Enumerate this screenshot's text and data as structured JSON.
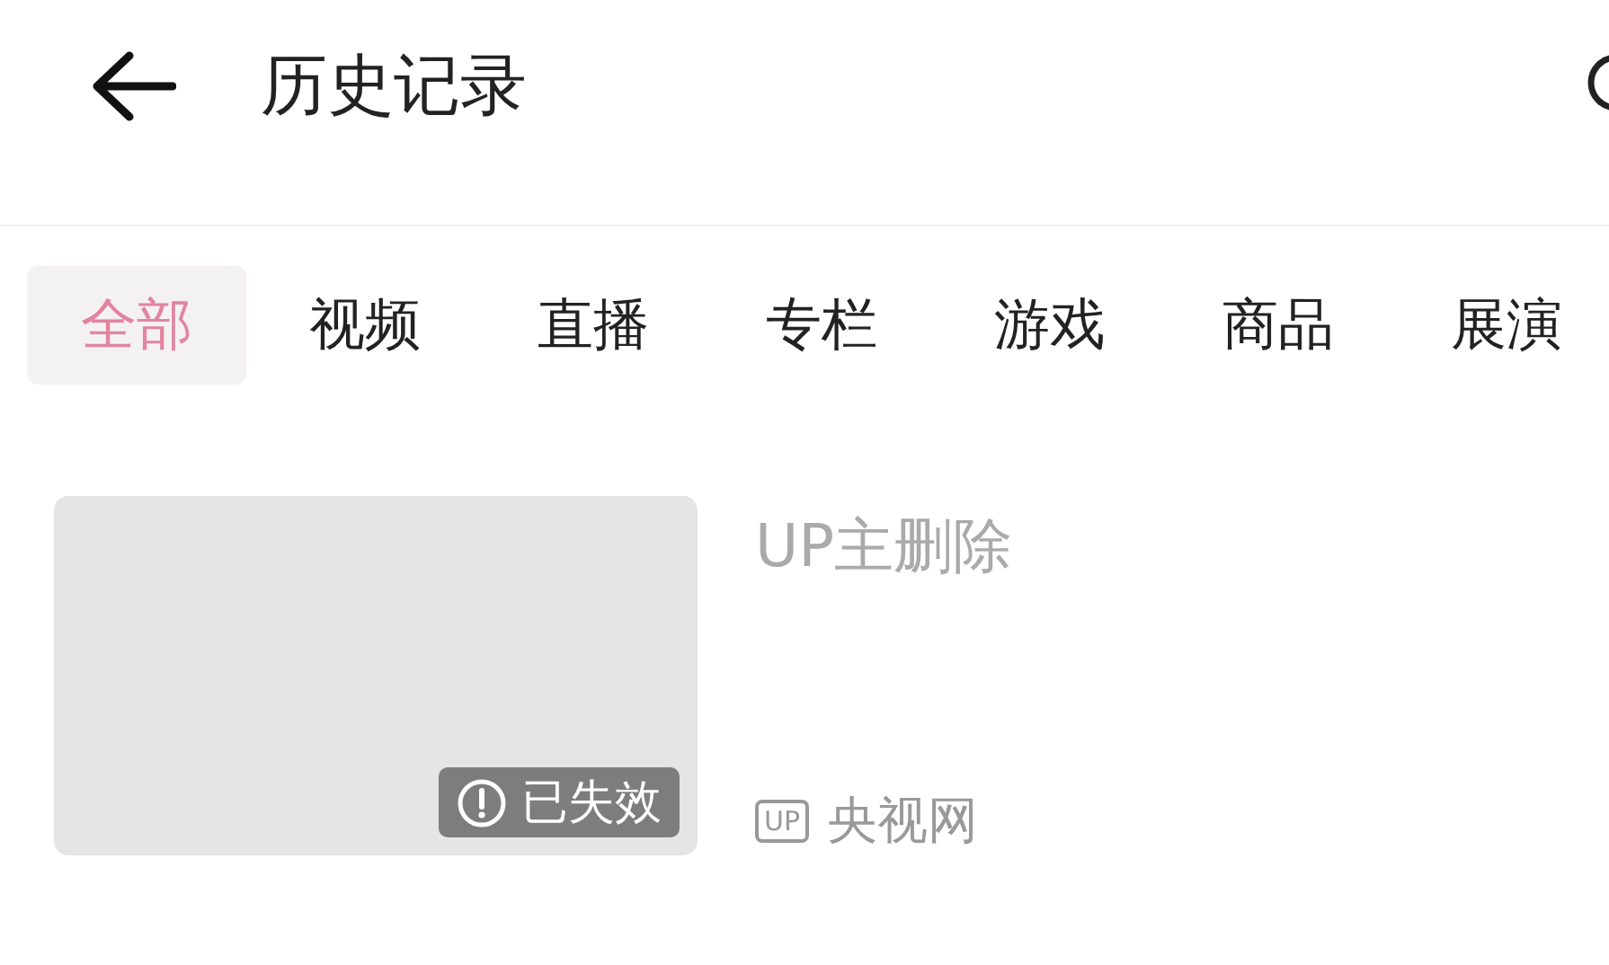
{
  "header": {
    "title": "历史记录"
  },
  "tabs": [
    {
      "label": "全部",
      "selected": true
    },
    {
      "label": "视频",
      "selected": false
    },
    {
      "label": "直播",
      "selected": false
    },
    {
      "label": "专栏",
      "selected": false
    },
    {
      "label": "游戏",
      "selected": false
    },
    {
      "label": "商品",
      "selected": false
    },
    {
      "label": "展演",
      "selected": false
    }
  ],
  "items": [
    {
      "kind": "invalid",
      "status": "已失效",
      "title": "UP主删除",
      "uploader_badge": "UP",
      "uploader": "央视网"
    }
  ]
}
